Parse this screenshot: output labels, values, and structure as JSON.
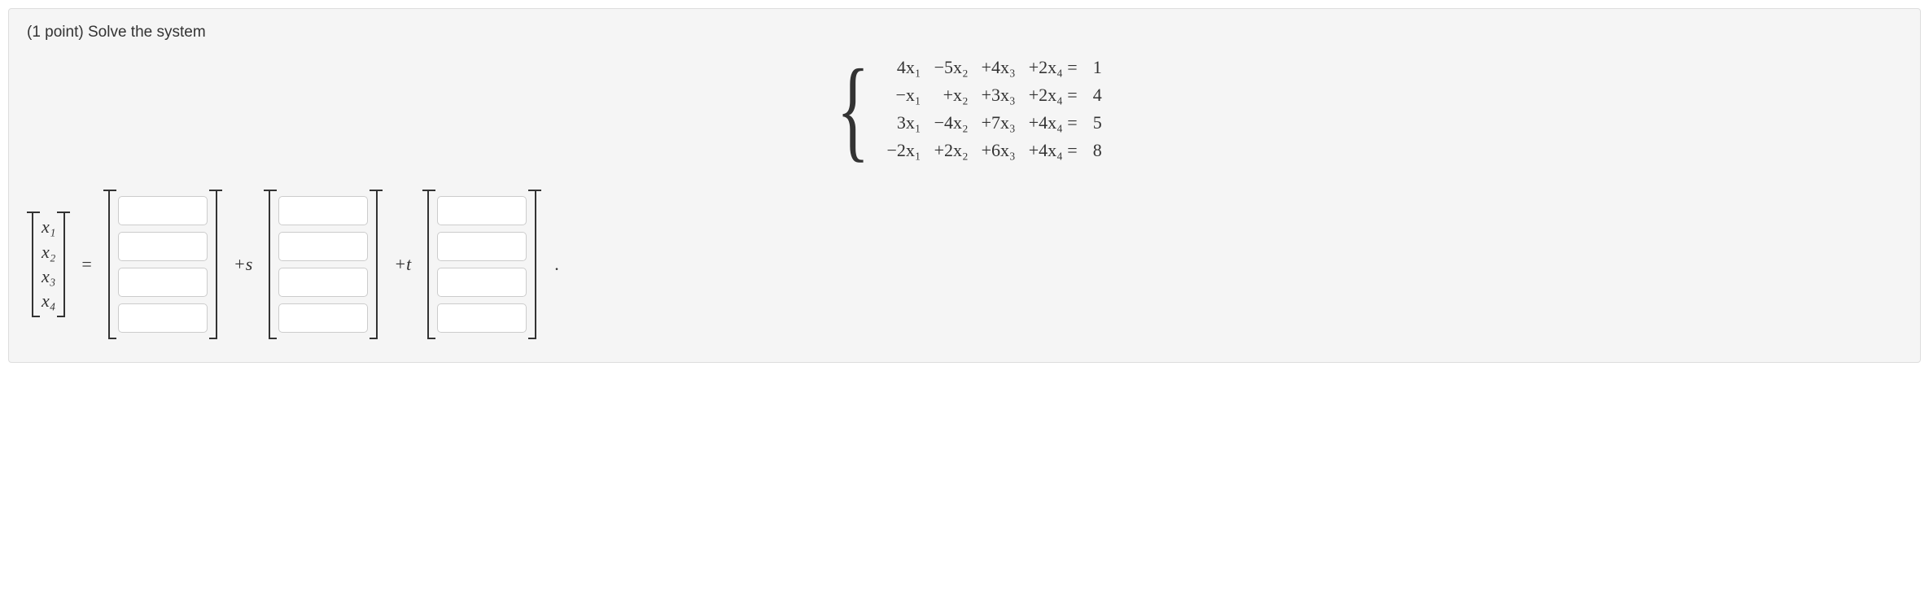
{
  "prompt": {
    "points_label": "(1 point)",
    "instruction": "Solve the system"
  },
  "system": {
    "rows": [
      {
        "c1": "4x₁",
        "c2": "−5x₂",
        "c3": "+4x₃",
        "c4": "+2x₄ =",
        "rhs": "1"
      },
      {
        "c1": "−x₁",
        "c2": "+x₂",
        "c3": "+3x₃",
        "c4": "+2x₄ =",
        "rhs": "4"
      },
      {
        "c1": "3x₁",
        "c2": "−4x₂",
        "c3": "+7x₃",
        "c4": "+4x₄ =",
        "rhs": "5"
      },
      {
        "c1": "−2x₁",
        "c2": "+2x₂",
        "c3": "+6x₃",
        "c4": "+4x₄ =",
        "rhs": "8"
      }
    ]
  },
  "answer": {
    "vars": [
      "x₁",
      "x₂",
      "x₃",
      "x₄"
    ],
    "equals": "=",
    "plus_s": "+s",
    "plus_t": "+t",
    "period": "."
  }
}
